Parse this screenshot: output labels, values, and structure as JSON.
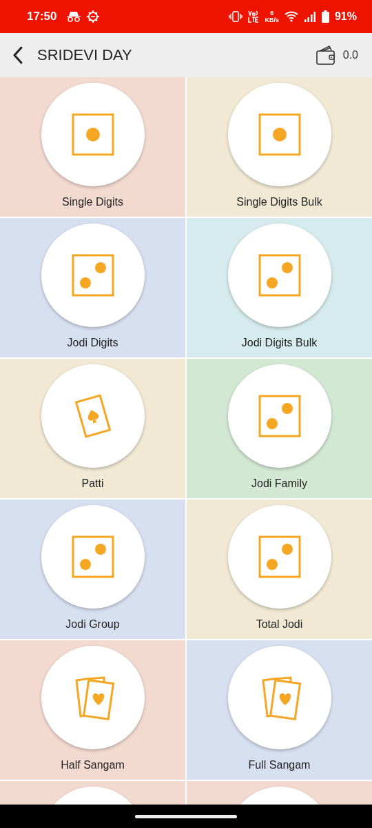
{
  "status_bar": {
    "time": "17:50",
    "network_speed_value": "6",
    "network_speed_unit": "KB/s",
    "battery": "91%"
  },
  "header": {
    "title": "SRIDEVI DAY",
    "wallet_balance": "0.0"
  },
  "tiles": [
    {
      "label": "Single Digits",
      "kind": "die-one",
      "color": "#f3dad0"
    },
    {
      "label": "Single Digits Bulk",
      "kind": "die-one",
      "color": "#f1e9d4"
    },
    {
      "label": "Jodi Digits",
      "kind": "die-two",
      "color": "#d7e0f0"
    },
    {
      "label": "Jodi Digits Bulk",
      "kind": "die-two",
      "color": "#d6ebed"
    },
    {
      "label": "Patti",
      "kind": "card",
      "color": "#f1e9d4"
    },
    {
      "label": "Jodi Family",
      "kind": "die-two",
      "color": "#d2e8d3"
    },
    {
      "label": "Jodi Group",
      "kind": "die-two",
      "color": "#d7e0f0"
    },
    {
      "label": "Total Jodi",
      "kind": "die-two",
      "color": "#f1e9d4"
    },
    {
      "label": "Half Sangam",
      "kind": "cards",
      "color": "#f3dad0"
    },
    {
      "label": "Full Sangam",
      "kind": "cards",
      "color": "#d7e0f0"
    },
    {
      "color": "#f3dad0"
    },
    {
      "color": "#f3dad0"
    }
  ]
}
